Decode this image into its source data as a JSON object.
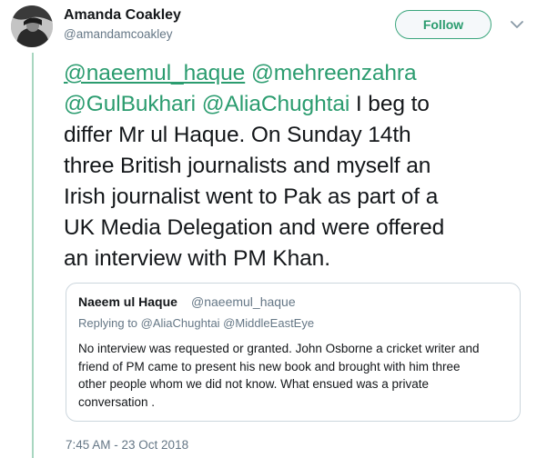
{
  "tweet": {
    "author_name": "Amanda Coakley",
    "author_handle": "@amandamcoakley",
    "follow_label": "Follow",
    "text_lines": [
      [
        {
          "text": "@naeemul_haque",
          "type": "mention-underlined"
        },
        {
          "text": " ",
          "type": "text"
        },
        {
          "text": "@mehreenzahra",
          "type": "mention"
        }
      ],
      [
        {
          "text": "@GulBukhari",
          "type": "mention"
        },
        {
          "text": " ",
          "type": "text"
        },
        {
          "text": "@AliaChughtai",
          "type": "mention"
        },
        {
          "text": " I beg to",
          "type": "text"
        }
      ],
      [
        {
          "text": "differ Mr ul Haque. On Sunday 14th",
          "type": "text"
        }
      ],
      [
        {
          "text": "three British journalists and myself an",
          "type": "text"
        }
      ],
      [
        {
          "text": "Irish journalist went to Pak as part of a",
          "type": "text"
        }
      ],
      [
        {
          "text": "UK Media Delegation and were offered",
          "type": "text"
        }
      ],
      [
        {
          "text": "an interview with PM Khan.",
          "type": "text"
        }
      ]
    ],
    "timestamp": "7:45 AM - 23 Oct 2018"
  },
  "quoted_tweet": {
    "author_name": "Naeem ul Haque",
    "author_handle": "@naeemul_haque",
    "replying_to": "Replying to @AliaChughtai @MiddleEastEye",
    "text_lines": [
      "No interview was requested or granted. John Osborne a cricket writer and",
      "friend of PM came to present his new book and brought with him three",
      "other people whom we did not know. What ensued was a private",
      "conversation ."
    ]
  },
  "colors": {
    "accent": "#2b9c6f",
    "thread_line": "#a8d6c0",
    "secondary_text": "#657786",
    "border": "#ccd6dd"
  },
  "icons": [
    "avatar",
    "chevron-down-icon"
  ]
}
